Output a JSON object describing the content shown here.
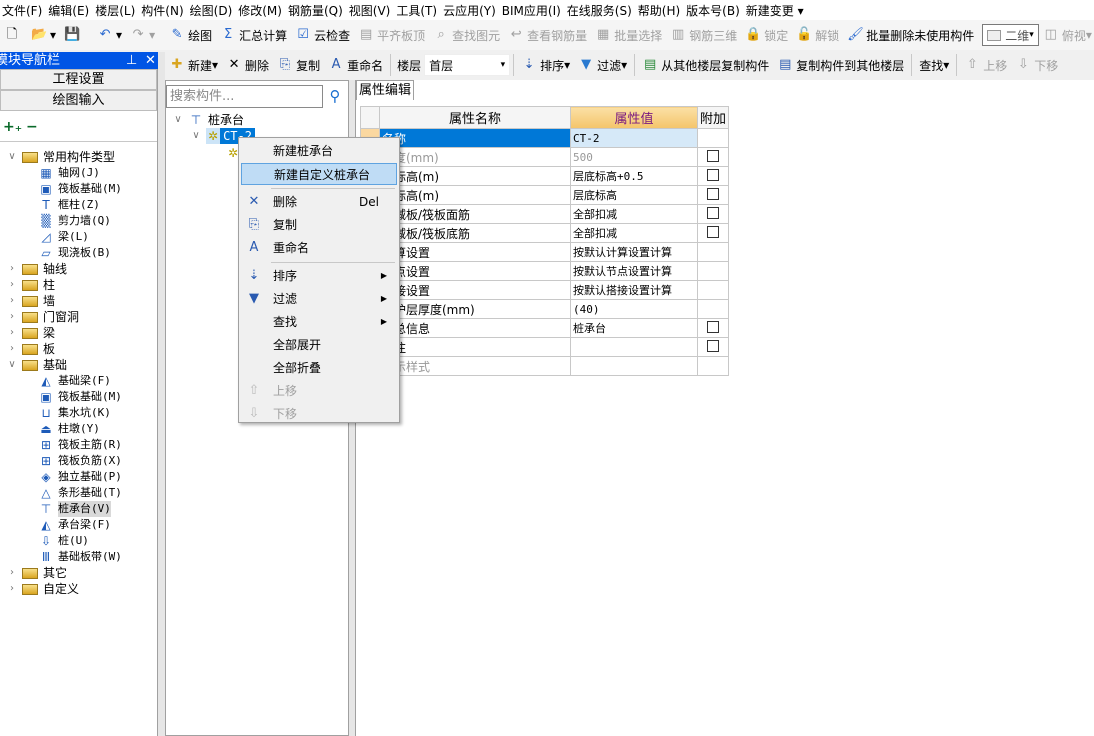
{
  "menubar": [
    "文件(F)",
    "编辑(E)",
    "楼层(L)",
    "构件(N)",
    "绘图(D)",
    "修改(M)",
    "钢筋量(Q)",
    "视图(V)",
    "工具(T)",
    "云应用(Y)",
    "BIM应用(I)",
    "在线服务(S)",
    "帮助(H)",
    "版本号(B)",
    "新建变更 ▾"
  ],
  "toolbar1": [
    {
      "icon": "draw-icon",
      "glyph": "✎",
      "label": "绘图",
      "dis": false
    },
    {
      "icon": "sigma-icon",
      "glyph": "Σ",
      "label": "汇总计算",
      "dis": false
    },
    {
      "icon": "cloud-check-icon",
      "glyph": "☑",
      "label": "云检查",
      "dis": false
    },
    {
      "icon": "align-slab-icon",
      "glyph": "▤",
      "label": "平齐板顶",
      "dis": true
    },
    {
      "icon": "binoculars-icon",
      "glyph": "⌕",
      "label": "查找图元",
      "dis": true
    },
    {
      "icon": "view-rebar-icon",
      "glyph": "↩",
      "label": "查看钢筋量",
      "dis": true
    },
    {
      "icon": "batch-select-icon",
      "glyph": "▦",
      "label": "批量选择",
      "dis": true
    },
    {
      "icon": "rebar-3d-icon",
      "glyph": "▥",
      "label": "钢筋三维",
      "dis": true
    },
    {
      "icon": "lock-icon",
      "glyph": "🔒",
      "label": "锁定",
      "dis": true
    },
    {
      "icon": "unlock-icon",
      "glyph": "🔓",
      "label": "解锁",
      "dis": true
    },
    {
      "icon": "brush-icon",
      "glyph": "🖌",
      "label": "批量删除未使用构件",
      "dis": false
    }
  ],
  "view_mode": "二维",
  "view_dir": "俯视",
  "nav": {
    "title": "模块导航栏",
    "btn_project": "工程设置",
    "btn_draw": "绘图输入"
  },
  "tree": [
    {
      "label": "常用构件类型",
      "level": 0,
      "folder": true,
      "open": true
    },
    {
      "label": "轴网(J)",
      "level": 1,
      "icon": "grid-icon",
      "glyph": "▦"
    },
    {
      "label": "筏板基础(M)",
      "level": 1,
      "icon": "raft-foundation-icon",
      "glyph": "▣"
    },
    {
      "label": "框柱(Z)",
      "level": 1,
      "icon": "column-icon",
      "glyph": "T"
    },
    {
      "label": "剪力墙(Q)",
      "level": 1,
      "icon": "shear-wall-icon",
      "glyph": "▒"
    },
    {
      "label": "梁(L)",
      "level": 1,
      "icon": "beam-icon",
      "glyph": "◿"
    },
    {
      "label": "现浇板(B)",
      "level": 1,
      "icon": "slab-icon",
      "glyph": "▱"
    },
    {
      "label": "轴线",
      "level": 0,
      "folder": true
    },
    {
      "label": "柱",
      "level": 0,
      "folder": true
    },
    {
      "label": "墙",
      "level": 0,
      "folder": true
    },
    {
      "label": "门窗洞",
      "level": 0,
      "folder": true
    },
    {
      "label": "梁",
      "level": 0,
      "folder": true
    },
    {
      "label": "板",
      "level": 0,
      "folder": true
    },
    {
      "label": "基础",
      "level": 0,
      "folder": true,
      "open": true
    },
    {
      "label": "基础梁(F)",
      "level": 1,
      "icon": "foundation-beam-icon",
      "glyph": "◭"
    },
    {
      "label": "筏板基础(M)",
      "level": 1,
      "icon": "raft-foundation-icon",
      "glyph": "▣"
    },
    {
      "label": "集水坑(K)",
      "level": 1,
      "icon": "sump-icon",
      "glyph": "⊔"
    },
    {
      "label": "柱墩(Y)",
      "level": 1,
      "icon": "column-pier-icon",
      "glyph": "⏏"
    },
    {
      "label": "筏板主筋(R)",
      "level": 1,
      "icon": "raft-main-rebar-icon",
      "glyph": "⊞"
    },
    {
      "label": "筏板负筋(X)",
      "level": 1,
      "icon": "raft-neg-rebar-icon",
      "glyph": "⊞"
    },
    {
      "label": "独立基础(P)",
      "level": 1,
      "icon": "isolated-foundation-icon",
      "glyph": "◈"
    },
    {
      "label": "条形基础(T)",
      "level": 1,
      "icon": "strip-foundation-icon",
      "glyph": "△"
    },
    {
      "label": "桩承台(V)",
      "level": 1,
      "icon": "pile-cap-icon",
      "glyph": "⊤",
      "selected": true
    },
    {
      "label": "承台梁(F)",
      "level": 1,
      "icon": "cap-beam-icon",
      "glyph": "◭"
    },
    {
      "label": "桩(U)",
      "level": 1,
      "icon": "pile-icon",
      "glyph": "⇩"
    },
    {
      "label": "基础板带(W)",
      "level": 1,
      "icon": "foundation-strip-icon",
      "glyph": "Ⅲ"
    },
    {
      "label": "其它",
      "level": 0,
      "folder": true
    },
    {
      "label": "自定义",
      "level": 0,
      "folder": true
    }
  ],
  "toolbar2": {
    "new": "新建",
    "delete": "删除",
    "copy": "复制",
    "rename": "重命名",
    "floor_label": "楼层",
    "floor_value": "首层",
    "sort": "排序",
    "filter": "过滤",
    "copy_from": "从其他楼层复制构件",
    "copy_to": "复制构件到其他楼层",
    "find": "查找",
    "up": "上移",
    "down": "下移"
  },
  "search": {
    "placeholder": "搜索构件..."
  },
  "comp_tree": {
    "root": "桩承台",
    "item": "CT-2"
  },
  "context_menu": [
    {
      "label": "新建桩承台"
    },
    {
      "label": "新建自定义桩承台",
      "highlighted": true
    },
    {
      "sep": true
    },
    {
      "label": "删除",
      "shortcut": "Del",
      "icon": "delete-icon",
      "glyph": "✕"
    },
    {
      "label": "复制",
      "icon": "copy-icon",
      "glyph": "⎘"
    },
    {
      "label": "重命名",
      "icon": "rename-icon",
      "glyph": "A"
    },
    {
      "sep": true
    },
    {
      "label": "排序",
      "icon": "sort-icon",
      "glyph": "⇣",
      "submenu": true
    },
    {
      "label": "过滤",
      "icon": "filter-icon",
      "glyph": "▼",
      "submenu": true
    },
    {
      "label": "查找",
      "submenu": true
    },
    {
      "label": "全部展开"
    },
    {
      "label": "全部折叠"
    },
    {
      "label": "上移",
      "icon": "up-icon",
      "glyph": "⇧",
      "disabled": true
    },
    {
      "label": "下移",
      "icon": "down-icon",
      "glyph": "⇩",
      "disabled": true
    }
  ],
  "props": {
    "tab": "属性编辑",
    "headers": [
      "属性名称",
      "属性值",
      "附加"
    ],
    "rows": [
      {
        "name": "名称",
        "value": "CT-2",
        "check": null,
        "selected": true
      },
      {
        "name": "高度(mm)",
        "value": "500",
        "check": false,
        "gray": true
      },
      {
        "name": "顶标高(m)",
        "value": "层底标高+0.5",
        "check": false
      },
      {
        "name": "底标高(m)",
        "value": "层底标高",
        "check": false
      },
      {
        "name": "扣减板/筏板面筋",
        "value": "全部扣减",
        "check": false
      },
      {
        "name": "扣减板/筏板底筋",
        "value": "全部扣减",
        "check": false
      },
      {
        "name": "计算设置",
        "value": "按默认计算设置计算",
        "check": null
      },
      {
        "name": "节点设置",
        "value": "按默认节点设置计算",
        "check": null
      },
      {
        "name": "搭接设置",
        "value": "按默认搭接设置计算",
        "check": null
      },
      {
        "name": "保护层厚度(mm)",
        "value": "(40)",
        "check": null
      },
      {
        "name": "汇总信息",
        "value": "桩承台",
        "check": false
      },
      {
        "name": "备注",
        "value": "",
        "check": false
      },
      {
        "name": "显示样式",
        "value": "",
        "check": null,
        "gray": true
      }
    ]
  },
  "colors": {
    "nav_header": "#0055e5",
    "selection": "#0078d7",
    "value_header": "#f4c46a",
    "menu_highlight": "#bfdcf5"
  }
}
